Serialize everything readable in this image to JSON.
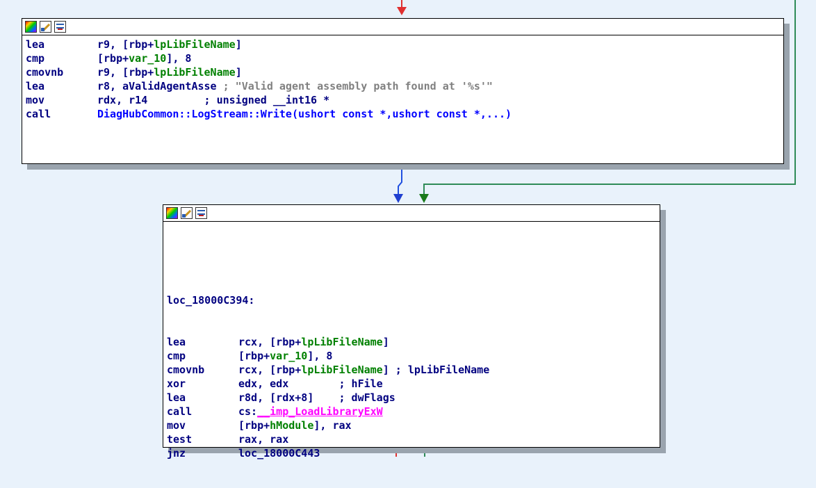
{
  "colors": {
    "background": "#e9f2fb",
    "mnemonic": "#000080",
    "name_ref": "#008000",
    "string_comment": "#808080",
    "function_name": "#0000ff",
    "import_ref": "#ff00ff",
    "edge_true": "#0000ff",
    "edge_false_up": "#e03030",
    "edge_jump": "#2e8b57"
  },
  "node_icons": [
    "palette-icon",
    "edit-icon",
    "graph-overview-icon"
  ],
  "block1": {
    "lines": [
      {
        "mnemonic": "lea",
        "parts": [
          {
            "t": "r9, [rbp+",
            "c": "blue"
          },
          {
            "t": "lpLibFileName",
            "c": "green"
          },
          {
            "t": "]",
            "c": "blue"
          }
        ]
      },
      {
        "mnemonic": "cmp",
        "parts": [
          {
            "t": "[rbp+",
            "c": "blue"
          },
          {
            "t": "var_10",
            "c": "green"
          },
          {
            "t": "], 8",
            "c": "blue"
          }
        ]
      },
      {
        "mnemonic": "cmovnb",
        "parts": [
          {
            "t": "r9, [rbp+",
            "c": "blue"
          },
          {
            "t": "lpLibFileName",
            "c": "green"
          },
          {
            "t": "]",
            "c": "blue"
          }
        ]
      },
      {
        "mnemonic": "lea",
        "parts": [
          {
            "t": "r8, ",
            "c": "blue"
          },
          {
            "t": "aValidAgentAsse",
            "c": "blue"
          },
          {
            "t": " ; \"Valid agent assembly path found at '%s'\"",
            "c": "gray"
          }
        ]
      },
      {
        "mnemonic": "mov",
        "parts": [
          {
            "t": "rdx, r14",
            "c": "blue"
          },
          {
            "t": "         ; unsigned __int16 *",
            "c": "blue"
          }
        ]
      },
      {
        "mnemonic": "call",
        "parts": [
          {
            "t": "DiagHubCommon::LogStream::Write(ushort const *,ushort const *,...)",
            "c": "fn"
          }
        ]
      }
    ]
  },
  "block2": {
    "label": "loc_18000C394:",
    "lines": [
      {
        "mnemonic": "lea",
        "parts": [
          {
            "t": "rcx, [rbp+",
            "c": "blue"
          },
          {
            "t": "lpLibFileName",
            "c": "green"
          },
          {
            "t": "]",
            "c": "blue"
          }
        ]
      },
      {
        "mnemonic": "cmp",
        "parts": [
          {
            "t": "[rbp+",
            "c": "blue"
          },
          {
            "t": "var_10",
            "c": "green"
          },
          {
            "t": "], 8",
            "c": "blue"
          }
        ]
      },
      {
        "mnemonic": "cmovnb",
        "parts": [
          {
            "t": "rcx, [rbp+",
            "c": "blue"
          },
          {
            "t": "lpLibFileName",
            "c": "green"
          },
          {
            "t": "] ; lpLibFileName",
            "c": "blue"
          }
        ]
      },
      {
        "mnemonic": "xor",
        "parts": [
          {
            "t": "edx, edx",
            "c": "blue"
          },
          {
            "t": "        ; hFile",
            "c": "blue"
          }
        ]
      },
      {
        "mnemonic": "lea",
        "parts": [
          {
            "t": "r8d, [rdx+8]",
            "c": "blue"
          },
          {
            "t": "    ; dwFlags",
            "c": "blue"
          }
        ]
      },
      {
        "mnemonic": "call",
        "parts": [
          {
            "t": "cs:",
            "c": "blue"
          },
          {
            "t": "__imp_LoadLibraryExW",
            "c": "pink"
          }
        ]
      },
      {
        "mnemonic": "mov",
        "parts": [
          {
            "t": "[rbp+",
            "c": "blue"
          },
          {
            "t": "hModule",
            "c": "green"
          },
          {
            "t": "], rax",
            "c": "blue"
          }
        ]
      },
      {
        "mnemonic": "test",
        "parts": [
          {
            "t": "rax, rax",
            "c": "blue"
          }
        ]
      },
      {
        "mnemonic": "jnz",
        "parts": [
          {
            "t": "loc_18000C443",
            "c": "blue"
          }
        ]
      }
    ]
  }
}
